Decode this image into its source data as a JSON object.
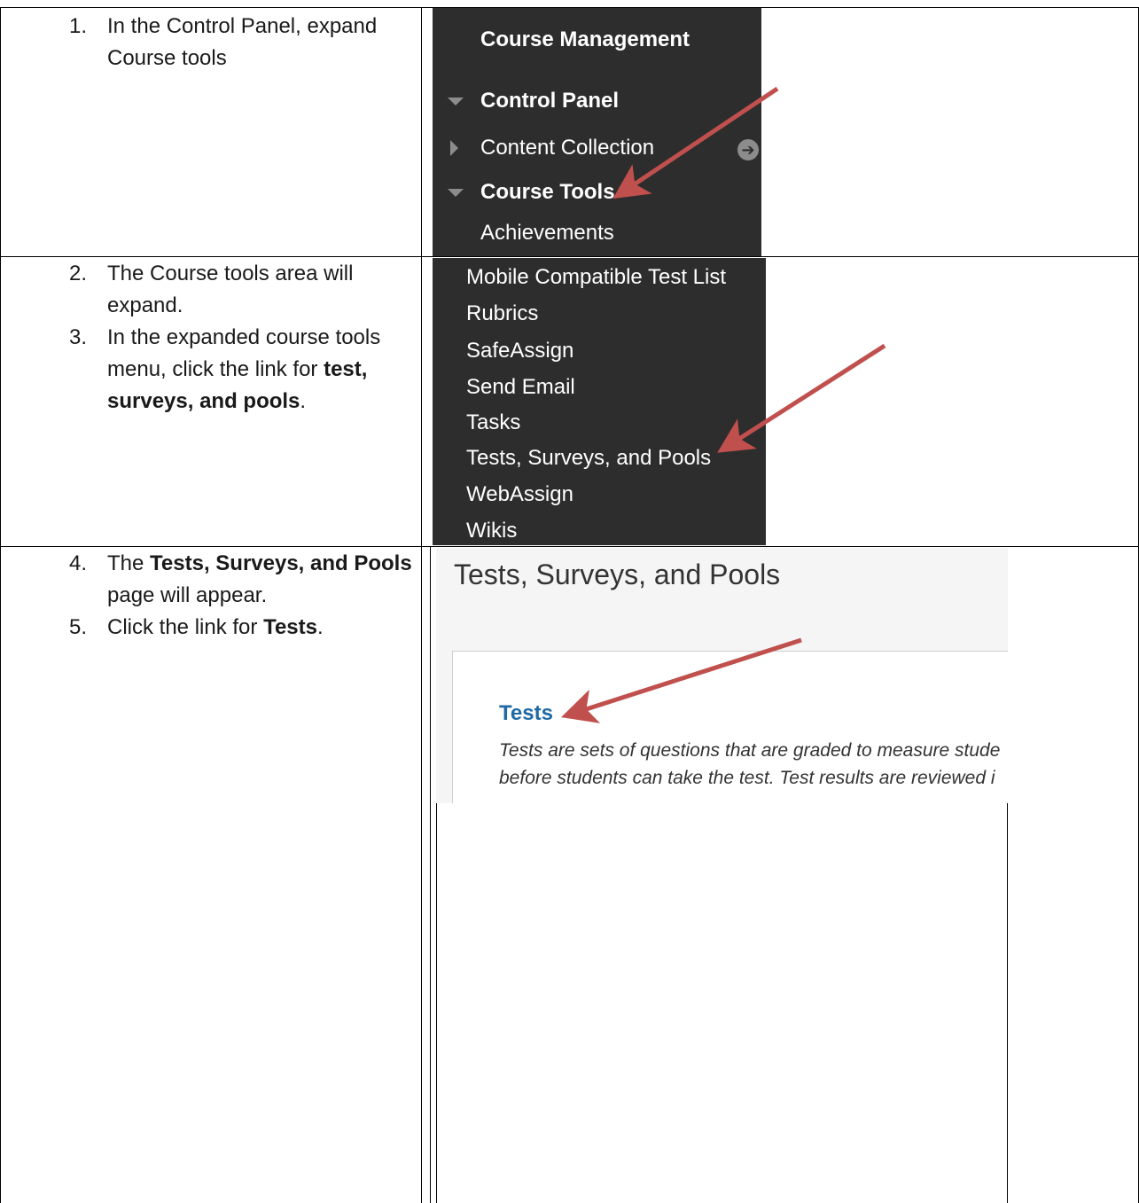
{
  "row1": {
    "step_number": "1.",
    "step_text": "In the Control Panel, expand Course tools",
    "menu": {
      "heading": "Course Management",
      "control_panel": "Control Panel",
      "content_collection": "Content Collection",
      "course_tools": "Course Tools",
      "achievements": "Achievements"
    }
  },
  "row2": {
    "steps": [
      {
        "number": "2.",
        "text": "The Course tools area will expand."
      },
      {
        "number": "3.",
        "text_before": "In the expanded course tools menu, click the link for ",
        "bold": "test, surveys, and pools",
        "text_after": "."
      }
    ],
    "menu_items": [
      "Mobile Compatible Test List",
      "Rubrics",
      "SafeAssign",
      "Send Email",
      "Tasks",
      "Tests, Surveys, and Pools",
      "WebAssign",
      "Wikis"
    ]
  },
  "row3": {
    "steps": [
      {
        "number": "4.",
        "text_before": "The ",
        "bold": "Tests, Surveys, and Pools",
        "text_after": " page will appear."
      },
      {
        "number": "5.",
        "text_before": "Click the link for ",
        "bold": "Tests",
        "text_after": "."
      }
    ],
    "page": {
      "title": "Tests, Surveys, and Pools",
      "link": "Tests",
      "description_line1": "Tests are sets of questions that are graded to measure stude",
      "description_line2": "before students can take the test. Test results are reviewed i"
    }
  },
  "colors": {
    "menu_bg": "#2d2d2d",
    "arrow": "#c0504d",
    "link": "#1f6aa5"
  }
}
